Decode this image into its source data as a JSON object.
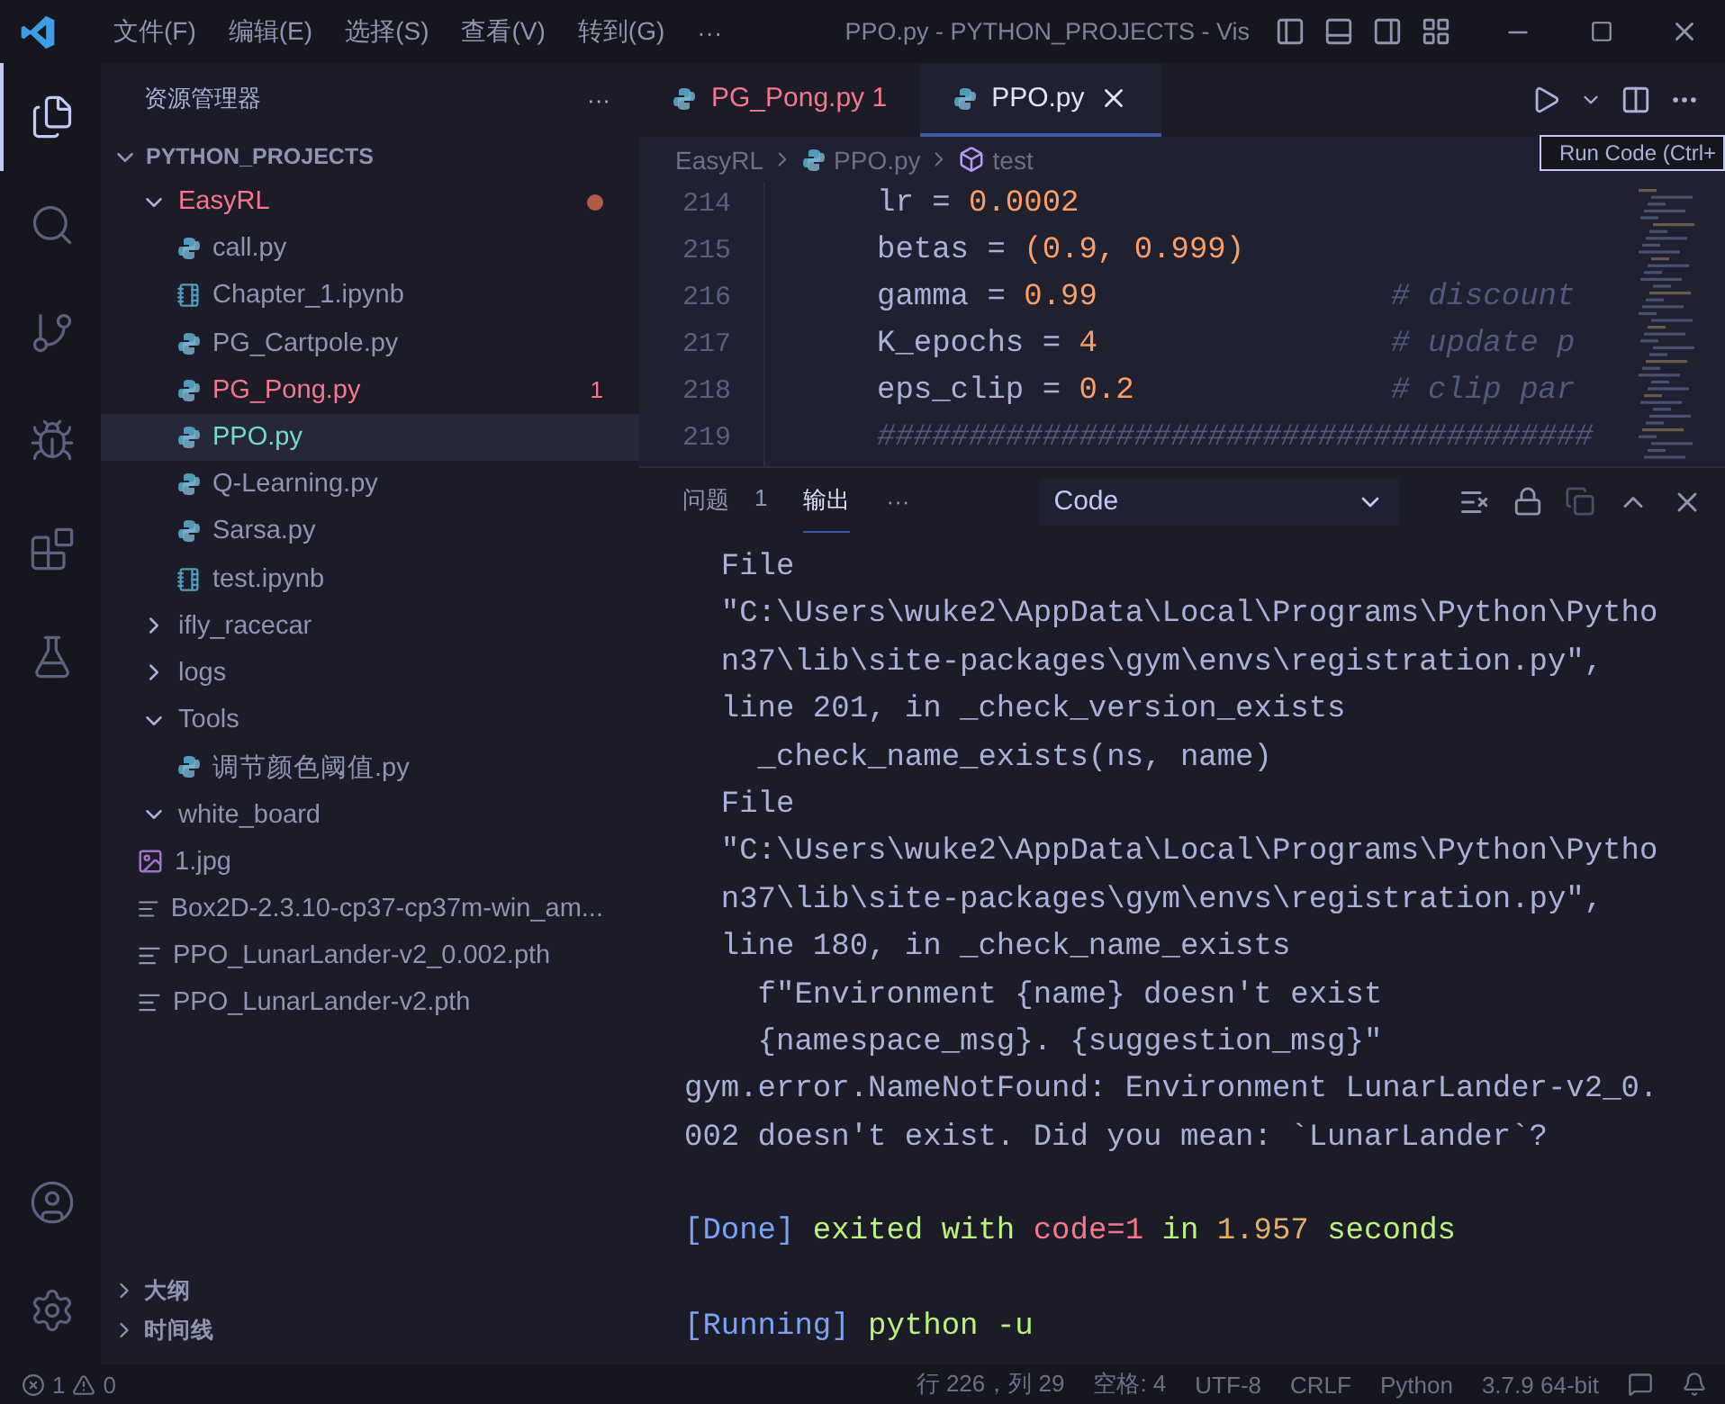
{
  "title_bar": {
    "menus": [
      "文件(F)",
      "编辑(E)",
      "选择(S)",
      "查看(V)",
      "转到(G)",
      "···"
    ],
    "title": "PPO.py - PYTHON_PROJECTS - Vis"
  },
  "activity_bar": {
    "items": [
      {
        "kind": "explorer",
        "selected": true
      },
      {
        "kind": "search",
        "selected": false
      },
      {
        "kind": "source-control",
        "selected": false
      },
      {
        "kind": "debug",
        "selected": false
      },
      {
        "kind": "extensions",
        "selected": false
      },
      {
        "kind": "testing",
        "selected": false
      }
    ],
    "bottom": [
      {
        "kind": "account"
      },
      {
        "kind": "settings"
      }
    ]
  },
  "sidebar": {
    "title": "资源管理器",
    "more": "···",
    "section": {
      "title": "PYTHON_PROJECTS",
      "expanded": true
    },
    "tree": [
      {
        "name": "EasyRL",
        "kind": "folder",
        "expanded": true,
        "selected": false,
        "problem": true,
        "untracked": false,
        "children": [
          {
            "name": "call.py",
            "kind": "python",
            "selected": false,
            "problem": false,
            "untracked": false
          },
          {
            "name": "Chapter_1.ipynb",
            "kind": "notebook",
            "selected": false,
            "problem": false,
            "untracked": false
          },
          {
            "name": "PG_Cartpole.py",
            "kind": "python",
            "selected": false,
            "problem": false,
            "untracked": false
          },
          {
            "name": "PG_Pong.py",
            "kind": "python",
            "selected": false,
            "problem": true,
            "untracked": false,
            "badge": "1"
          },
          {
            "name": "PPO.py",
            "kind": "python",
            "selected": true,
            "problem": false,
            "untracked": true
          },
          {
            "name": "Q-Learning.py",
            "kind": "python",
            "selected": false,
            "problem": false,
            "untracked": false
          },
          {
            "name": "Sarsa.py",
            "kind": "python",
            "selected": false,
            "problem": false,
            "untracked": false
          },
          {
            "name": "test.ipynb",
            "kind": "notebook",
            "selected": false,
            "problem": false,
            "untracked": false
          }
        ]
      },
      {
        "name": "ifly_racecar",
        "kind": "folder",
        "expanded": false,
        "selected": false,
        "problem": false,
        "untracked": false
      },
      {
        "name": "logs",
        "kind": "folder",
        "expanded": false,
        "selected": false,
        "problem": false,
        "untracked": false
      },
      {
        "name": "Tools",
        "kind": "folder",
        "expanded": true,
        "selected": false,
        "problem": false,
        "untracked": false,
        "children": [
          {
            "name": "调节颜色阈值.py",
            "kind": "python",
            "selected": false,
            "problem": false,
            "untracked": false
          }
        ]
      },
      {
        "name": "white_board",
        "kind": "folder",
        "expanded": true,
        "selected": false,
        "problem": false,
        "untracked": false
      },
      {
        "name": "1.jpg",
        "kind": "image",
        "selected": false,
        "problem": false,
        "untracked": false
      },
      {
        "name": "Box2D-2.3.10-cp37-cp37m-win_am...",
        "kind": "text",
        "selected": false,
        "problem": false,
        "untracked": false
      },
      {
        "name": "PPO_LunarLander-v2_0.002.pth",
        "kind": "text",
        "selected": false,
        "problem": false,
        "untracked": false
      },
      {
        "name": "PPO_LunarLander-v2.pth",
        "kind": "text",
        "selected": false,
        "problem": false,
        "untracked": false
      }
    ],
    "bottom_sections": [
      {
        "title": "大纲",
        "expanded": false
      },
      {
        "title": "时间线",
        "expanded": false
      }
    ]
  },
  "editor": {
    "tabs": [
      {
        "label": "PG_Pong.py 1",
        "selected": false,
        "problem": true
      },
      {
        "label": "PPO.py",
        "selected": true,
        "problem": false
      }
    ],
    "breadcrumbs": [
      {
        "label": "EasyRL",
        "kind": "folder"
      },
      {
        "label": "PPO.py",
        "kind": "python"
      },
      {
        "label": "test",
        "kind": "symbol"
      }
    ],
    "tooltip": "Run Code (Ctrl+",
    "lines": [
      {
        "number": "214",
        "segments": [
          {
            "kind": "plain",
            "text": "lr = "
          },
          {
            "kind": "number",
            "text": "0.0002"
          }
        ]
      },
      {
        "number": "215",
        "segments": [
          {
            "kind": "plain",
            "text": "betas = "
          },
          {
            "kind": "number",
            "text": "(0.9, 0.999)"
          }
        ]
      },
      {
        "number": "216",
        "segments": [
          {
            "kind": "plain",
            "text": "gamma = "
          },
          {
            "kind": "number",
            "text": "0.99"
          },
          {
            "kind": "comment",
            "text": "# discount"
          }
        ]
      },
      {
        "number": "217",
        "segments": [
          {
            "kind": "plain",
            "text": "K_epochs = "
          },
          {
            "kind": "number",
            "text": "4"
          },
          {
            "kind": "comment",
            "text": "# update p"
          }
        ]
      },
      {
        "number": "218",
        "segments": [
          {
            "kind": "plain",
            "text": "eps_clip = "
          },
          {
            "kind": "number",
            "text": "0.2"
          },
          {
            "kind": "comment",
            "text": "# clip par"
          }
        ]
      },
      {
        "number": "219",
        "segments": [
          {
            "kind": "comment",
            "text": "#######################################"
          }
        ]
      }
    ]
  },
  "panel": {
    "tabs": [
      {
        "label": "问题",
        "badge": "1",
        "selected": false
      },
      {
        "label": "输出",
        "selected": true
      }
    ],
    "more": "···",
    "channel": "Code",
    "output": [
      {
        "kind": "text",
        "segments": [
          {
            "kind": "plain",
            "text": "  File"
          }
        ]
      },
      {
        "kind": "text",
        "segments": [
          {
            "kind": "plain",
            "text": "  \"C:\\Users\\wuke2\\AppData\\Local\\Programs\\Python\\Pytho"
          }
        ]
      },
      {
        "kind": "text",
        "segments": [
          {
            "kind": "plain",
            "text": "  n37\\lib\\site-packages\\gym\\envs\\registration.py\","
          }
        ]
      },
      {
        "kind": "text",
        "segments": [
          {
            "kind": "plain",
            "text": "  line 201, in _check_version_exists"
          }
        ]
      },
      {
        "kind": "text",
        "segments": [
          {
            "kind": "plain",
            "text": "    _check_name_exists(ns, name)"
          }
        ]
      },
      {
        "kind": "text",
        "segments": [
          {
            "kind": "plain",
            "text": "  File"
          }
        ]
      },
      {
        "kind": "text",
        "segments": [
          {
            "kind": "plain",
            "text": "  \"C:\\Users\\wuke2\\AppData\\Local\\Programs\\Python\\Pytho"
          }
        ]
      },
      {
        "kind": "text",
        "segments": [
          {
            "kind": "plain",
            "text": "  n37\\lib\\site-packages\\gym\\envs\\registration.py\","
          }
        ]
      },
      {
        "kind": "text",
        "segments": [
          {
            "kind": "plain",
            "text": "  line 180, in _check_name_exists"
          }
        ]
      },
      {
        "kind": "text",
        "segments": [
          {
            "kind": "plain",
            "text": "    f\"Environment {name} doesn't exist"
          }
        ]
      },
      {
        "kind": "text",
        "segments": [
          {
            "kind": "plain",
            "text": "    {namespace_msg}. {suggestion_msg}\""
          }
        ]
      },
      {
        "kind": "text",
        "segments": [
          {
            "kind": "plain",
            "text": "gym.error.NameNotFound: Environment LunarLander-v2_0."
          }
        ]
      },
      {
        "kind": "text",
        "segments": [
          {
            "kind": "plain",
            "text": "002 doesn't exist. Did you mean: `LunarLander`?"
          }
        ]
      },
      {
        "kind": "blank"
      },
      {
        "kind": "text",
        "segments": [
          {
            "kind": "tag",
            "text": "[Done]"
          },
          {
            "kind": "success",
            "text": " exited with "
          },
          {
            "kind": "error",
            "text": "code=1"
          },
          {
            "kind": "success",
            "text": " in "
          },
          {
            "kind": "number",
            "text": "1.957"
          },
          {
            "kind": "success",
            "text": " seconds"
          }
        ]
      },
      {
        "kind": "blank"
      },
      {
        "kind": "text",
        "segments": [
          {
            "kind": "tag",
            "text": "[Running]"
          },
          {
            "kind": "success",
            "text": " python -u"
          }
        ]
      }
    ]
  },
  "status_bar": {
    "errors": "1",
    "warnings": "0",
    "items": [
      "行 226，列 29",
      "空格: 4",
      "UTF-8",
      "CRLF",
      "Python",
      "3.7.9 64-bit"
    ]
  }
}
